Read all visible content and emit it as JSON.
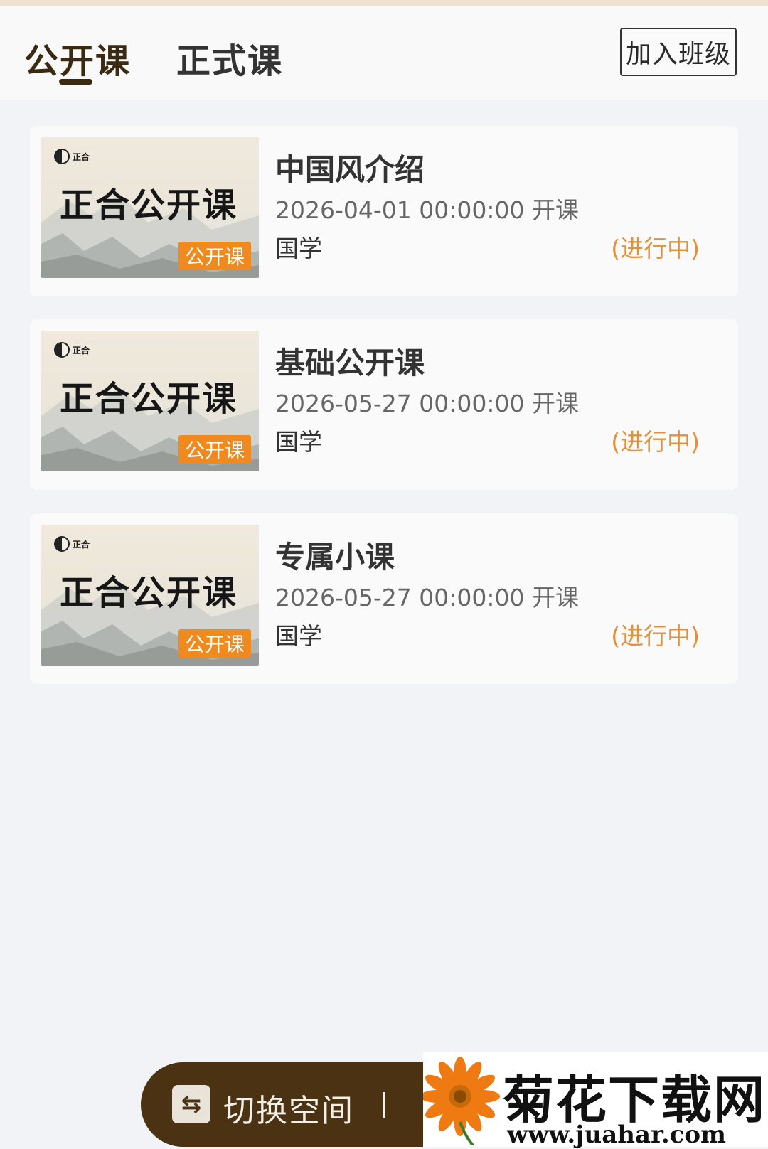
{
  "header": {
    "tabs": [
      {
        "label": "公开课",
        "active": true
      },
      {
        "label": "正式课",
        "active": false
      }
    ],
    "join_button": "加入班级"
  },
  "thumbnail": {
    "logo_text": "正合",
    "title": "正合公开课",
    "badge": "公开课"
  },
  "courses": [
    {
      "title": "中国风介绍",
      "date": "2026-04-01 00:00:00 开课",
      "category": "国学",
      "status": "(进行中)"
    },
    {
      "title": "基础公开课",
      "date": "2026-05-27 00:00:00 开课",
      "category": "国学",
      "status": "(进行中)"
    },
    {
      "title": "专属小课",
      "date": "2026-05-27 00:00:00 开课",
      "category": "国学",
      "status": "(进行中)"
    }
  ],
  "bottom_bar": {
    "icon": "switch-icon",
    "label": "切换空间"
  },
  "watermark": {
    "title": "菊花下载网",
    "url": "www.juahar.com"
  },
  "colors": {
    "accent_dark_brown": "#3a2a12",
    "badge_orange": "#f08a1e",
    "status_orange": "#e0913a",
    "bar_brown": "#4a3212"
  }
}
